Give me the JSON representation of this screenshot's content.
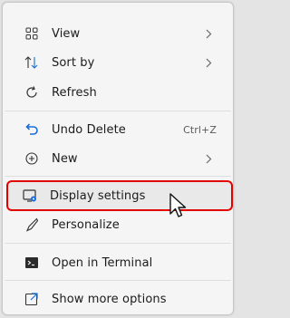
{
  "menu": {
    "items": [
      {
        "label": "View",
        "icon": "grid-icon",
        "submenu": true
      },
      {
        "label": "Sort by",
        "icon": "sort-icon",
        "submenu": true
      },
      {
        "label": "Refresh",
        "icon": "refresh-icon",
        "submenu": false
      },
      {
        "label": "Undo Delete",
        "icon": "undo-icon",
        "shortcut": "Ctrl+Z",
        "submenu": false
      },
      {
        "label": "New",
        "icon": "plus-circle-icon",
        "submenu": true
      },
      {
        "label": "Display settings",
        "icon": "display-icon",
        "submenu": false,
        "highlighted": true
      },
      {
        "label": "Personalize",
        "icon": "brush-icon",
        "submenu": false
      },
      {
        "label": "Open in Terminal",
        "icon": "terminal-icon",
        "submenu": false
      },
      {
        "label": "Show more options",
        "icon": "external-icon",
        "submenu": false
      }
    ]
  },
  "colors": {
    "menu_bg": "#f5f5f5",
    "highlight_outline": "#e30000",
    "accent_blue": "#1a6fd6"
  }
}
